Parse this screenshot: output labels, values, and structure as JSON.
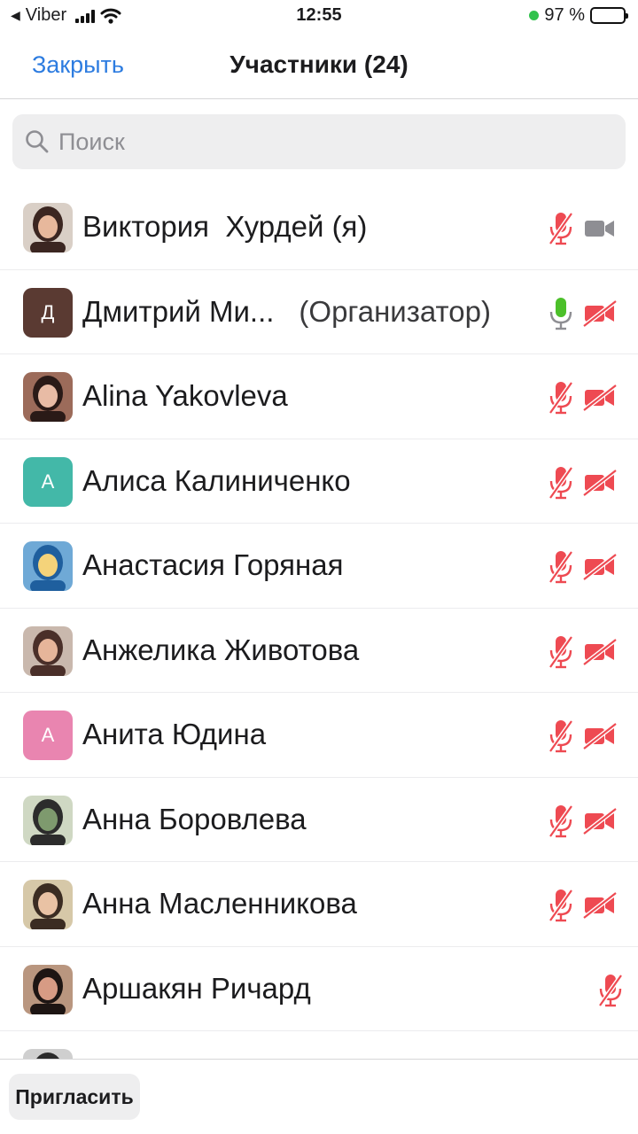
{
  "status_bar": {
    "back_app": "Viber",
    "time": "12:55",
    "battery_percent": "97 %",
    "battery_level": 0.97
  },
  "nav": {
    "close_label": "Закрыть",
    "title": "Участники (24)"
  },
  "search": {
    "placeholder": "Поиск"
  },
  "colors": {
    "accent_blue": "#2d7ce0",
    "muted_red": "#ee4a52",
    "mic_green": "#4cc02a",
    "video_gray": "#8e8e93"
  },
  "participants": [
    {
      "name": "Виктория  Хурдей (я)",
      "role": "",
      "avatar": "photo",
      "mic": "muted",
      "video": "on"
    },
    {
      "name": "Дмитрий Ми...",
      "role": "(Организатор)",
      "avatar": "letter",
      "avatar_letter": "Д",
      "avatar_color": "#5a3a32",
      "mic": "on",
      "video": "off"
    },
    {
      "name": "Alina Yakovleva",
      "role": "",
      "avatar": "photo",
      "mic": "muted",
      "video": "off"
    },
    {
      "name": "Алиса Калиниченко",
      "role": "",
      "avatar": "letter",
      "avatar_letter": "А",
      "avatar_color": "#43b8a8",
      "mic": "muted",
      "video": "off"
    },
    {
      "name": "Анастасия Горяная",
      "role": "",
      "avatar": "photo",
      "mic": "muted",
      "video": "off"
    },
    {
      "name": "Анжелика Животова",
      "role": "",
      "avatar": "photo",
      "mic": "muted",
      "video": "off"
    },
    {
      "name": "Анита Юдина",
      "role": "",
      "avatar": "letter",
      "avatar_letter": "А",
      "avatar_color": "#e985b0",
      "mic": "muted",
      "video": "off"
    },
    {
      "name": "Анна Боровлева",
      "role": "",
      "avatar": "photo",
      "mic": "muted",
      "video": "off"
    },
    {
      "name": "Анна Масленникова",
      "role": "",
      "avatar": "photo",
      "mic": "muted",
      "video": "off"
    },
    {
      "name": "Аршакян Ричард",
      "role": "",
      "avatar": "photo",
      "mic": "muted",
      "video": "none"
    },
    {
      "name": "",
      "role": "",
      "avatar": "photo",
      "mic": "none",
      "video": "none"
    }
  ],
  "bottom": {
    "invite_label": "Пригласить"
  }
}
